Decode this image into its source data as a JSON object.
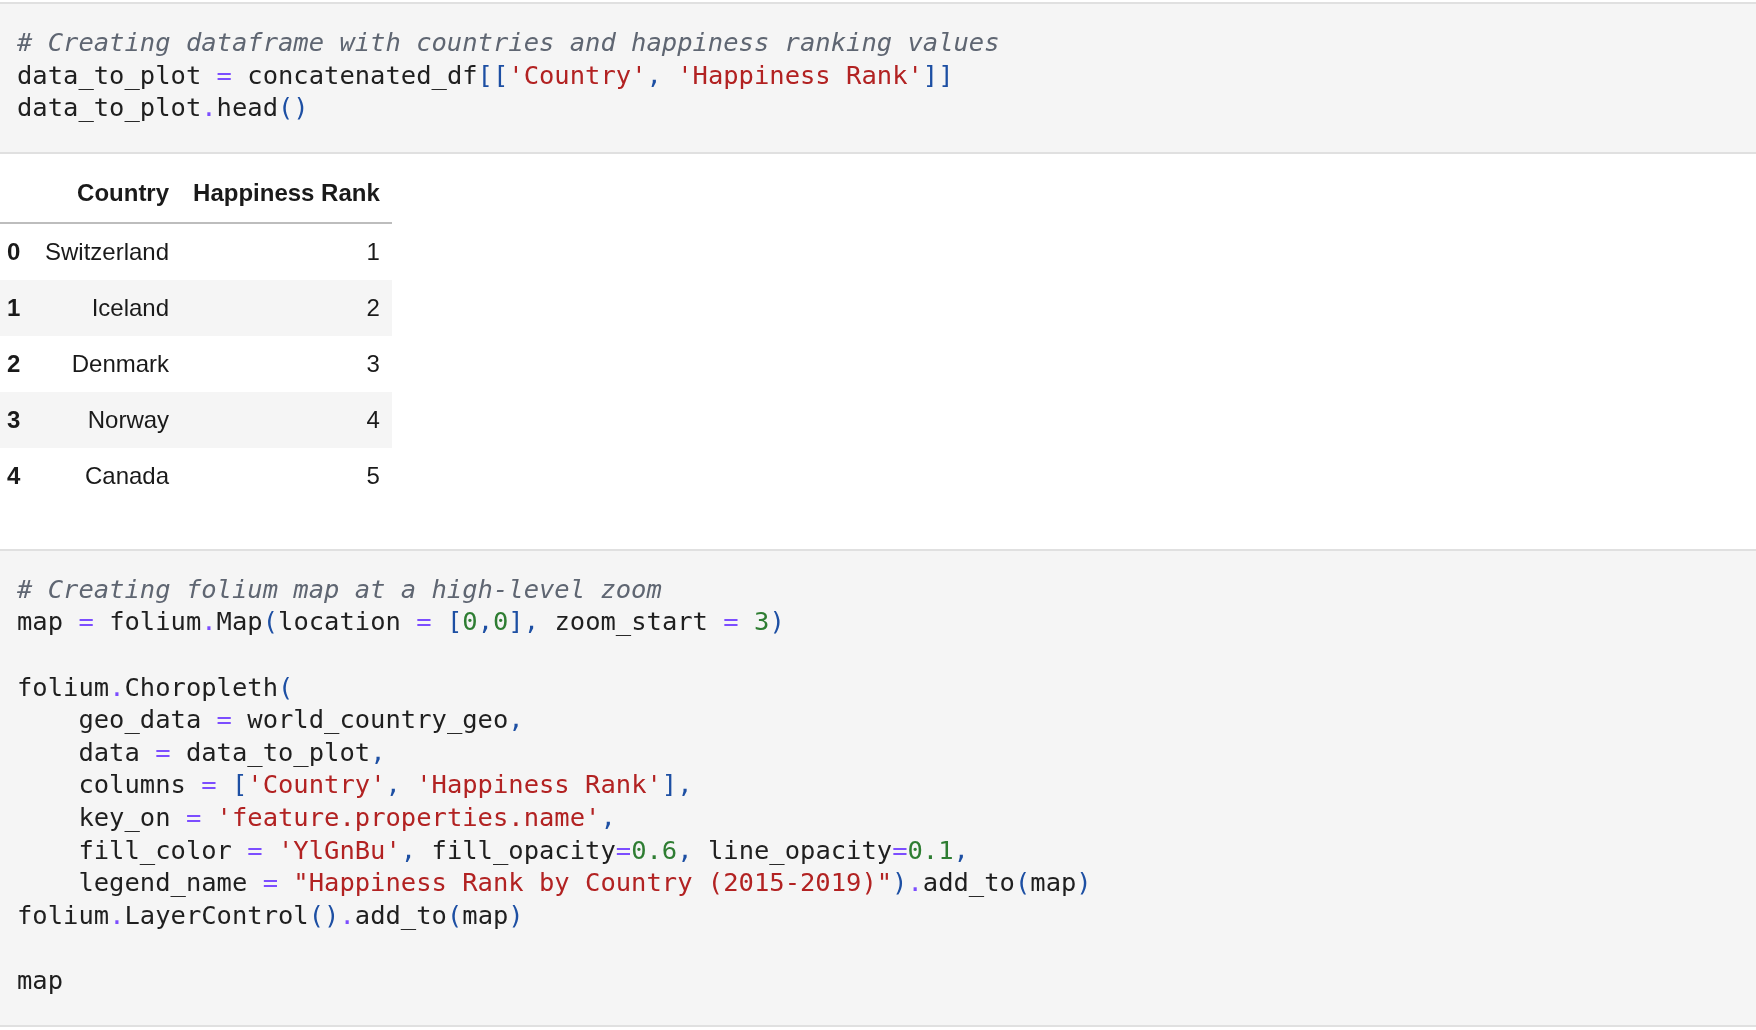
{
  "cells": [
    {
      "kind": "code",
      "lines": [
        {
          "tokens": [
            {
              "kind": "comment",
              "text": "# Creating dataframe with countries and happiness ranking values"
            }
          ]
        },
        {
          "tokens": [
            {
              "kind": "name",
              "text": "data_to_plot "
            },
            {
              "kind": "op",
              "text": "="
            },
            {
              "kind": "name",
              "text": " concatenated_df"
            },
            {
              "kind": "punct",
              "text": "[["
            },
            {
              "kind": "string",
              "text": "'Country'"
            },
            {
              "kind": "punct",
              "text": ", "
            },
            {
              "kind": "string",
              "text": "'Happiness Rank'"
            },
            {
              "kind": "punct",
              "text": "]]"
            }
          ]
        },
        {
          "tokens": [
            {
              "kind": "name",
              "text": "data_to_plot"
            },
            {
              "kind": "op",
              "text": "."
            },
            {
              "kind": "name",
              "text": "head"
            },
            {
              "kind": "punct",
              "text": "()"
            }
          ]
        }
      ]
    },
    {
      "kind": "table",
      "columns": [
        "Country",
        "Happiness Rank"
      ],
      "rows": [
        {
          "index": "0",
          "cells": [
            "Switzerland",
            "1"
          ]
        },
        {
          "index": "1",
          "cells": [
            "Iceland",
            "2"
          ]
        },
        {
          "index": "2",
          "cells": [
            "Denmark",
            "3"
          ]
        },
        {
          "index": "3",
          "cells": [
            "Norway",
            "4"
          ]
        },
        {
          "index": "4",
          "cells": [
            "Canada",
            "5"
          ]
        }
      ]
    },
    {
      "kind": "code",
      "lines": [
        {
          "tokens": [
            {
              "kind": "comment",
              "text": "# Creating folium map at a high-level zoom"
            }
          ]
        },
        {
          "tokens": [
            {
              "kind": "name",
              "text": "map "
            },
            {
              "kind": "op",
              "text": "="
            },
            {
              "kind": "name",
              "text": " folium"
            },
            {
              "kind": "op",
              "text": "."
            },
            {
              "kind": "name",
              "text": "Map"
            },
            {
              "kind": "punct",
              "text": "("
            },
            {
              "kind": "name",
              "text": "location "
            },
            {
              "kind": "op",
              "text": "="
            },
            {
              "kind": "punct",
              "text": " ["
            },
            {
              "kind": "number",
              "text": "0"
            },
            {
              "kind": "punct",
              "text": ","
            },
            {
              "kind": "number",
              "text": "0"
            },
            {
              "kind": "punct",
              "text": "],"
            },
            {
              "kind": "name",
              "text": " zoom_start "
            },
            {
              "kind": "op",
              "text": "="
            },
            {
              "kind": "number",
              "text": " 3"
            },
            {
              "kind": "punct",
              "text": ")"
            }
          ]
        },
        {
          "gap_before": true,
          "tokens": [
            {
              "kind": "name",
              "text": "folium"
            },
            {
              "kind": "op",
              "text": "."
            },
            {
              "kind": "name",
              "text": "Choropleth"
            },
            {
              "kind": "punct",
              "text": "("
            }
          ]
        },
        {
          "tokens": [
            {
              "kind": "name",
              "text": "    geo_data "
            },
            {
              "kind": "op",
              "text": "="
            },
            {
              "kind": "name",
              "text": " world_country_geo"
            },
            {
              "kind": "punct",
              "text": ","
            }
          ]
        },
        {
          "tokens": [
            {
              "kind": "name",
              "text": "    data "
            },
            {
              "kind": "op",
              "text": "="
            },
            {
              "kind": "name",
              "text": " data_to_plot"
            },
            {
              "kind": "punct",
              "text": ","
            }
          ]
        },
        {
          "tokens": [
            {
              "kind": "name",
              "text": "    columns "
            },
            {
              "kind": "op",
              "text": "="
            },
            {
              "kind": "punct",
              "text": " ["
            },
            {
              "kind": "string",
              "text": "'Country'"
            },
            {
              "kind": "punct",
              "text": ", "
            },
            {
              "kind": "string",
              "text": "'Happiness Rank'"
            },
            {
              "kind": "punct",
              "text": "],"
            }
          ]
        },
        {
          "tokens": [
            {
              "kind": "name",
              "text": "    key_on "
            },
            {
              "kind": "op",
              "text": "="
            },
            {
              "kind": "string",
              "text": " 'feature.properties.name'"
            },
            {
              "kind": "punct",
              "text": ","
            }
          ]
        },
        {
          "tokens": [
            {
              "kind": "name",
              "text": "    fill_color "
            },
            {
              "kind": "op",
              "text": "="
            },
            {
              "kind": "string",
              "text": " 'YlGnBu'"
            },
            {
              "kind": "punct",
              "text": ", "
            },
            {
              "kind": "name",
              "text": "fill_opacity"
            },
            {
              "kind": "op",
              "text": "="
            },
            {
              "kind": "number",
              "text": "0.6"
            },
            {
              "kind": "punct",
              "text": ", "
            },
            {
              "kind": "name",
              "text": "line_opacity"
            },
            {
              "kind": "op",
              "text": "="
            },
            {
              "kind": "number",
              "text": "0.1"
            },
            {
              "kind": "punct",
              "text": ","
            }
          ]
        },
        {
          "tokens": [
            {
              "kind": "name",
              "text": "    legend_name "
            },
            {
              "kind": "op",
              "text": "="
            },
            {
              "kind": "string",
              "text": " \"Happiness Rank by Country (2015-2019)\""
            },
            {
              "kind": "punct",
              "text": ")"
            },
            {
              "kind": "op",
              "text": "."
            },
            {
              "kind": "name",
              "text": "add_to"
            },
            {
              "kind": "punct",
              "text": "("
            },
            {
              "kind": "name",
              "text": "map"
            },
            {
              "kind": "punct",
              "text": ")"
            }
          ]
        },
        {
          "tokens": [
            {
              "kind": "name",
              "text": "folium"
            },
            {
              "kind": "op",
              "text": "."
            },
            {
              "kind": "name",
              "text": "LayerControl"
            },
            {
              "kind": "punct",
              "text": "()"
            },
            {
              "kind": "op",
              "text": "."
            },
            {
              "kind": "name",
              "text": "add_to"
            },
            {
              "kind": "punct",
              "text": "("
            },
            {
              "kind": "name",
              "text": "map"
            },
            {
              "kind": "punct",
              "text": ")"
            }
          ]
        },
        {
          "gap_before": true,
          "tokens": [
            {
              "kind": "name",
              "text": "map"
            }
          ]
        }
      ]
    }
  ]
}
